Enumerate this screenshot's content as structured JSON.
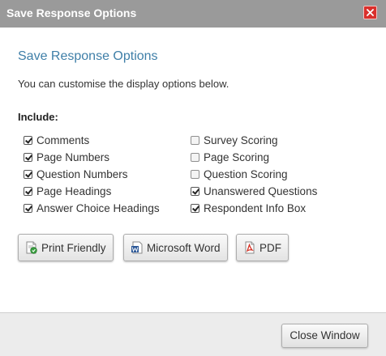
{
  "dialog": {
    "title": "Save Response Options",
    "heading": "Save Response Options",
    "description": "You can customise the display options below.",
    "include_label": "Include:"
  },
  "options_left": [
    {
      "label": "Comments",
      "checked": true
    },
    {
      "label": "Page Numbers",
      "checked": true
    },
    {
      "label": "Question Numbers",
      "checked": true
    },
    {
      "label": "Page Headings",
      "checked": true
    },
    {
      "label": "Answer Choice Headings",
      "checked": true
    }
  ],
  "options_right": [
    {
      "label": "Survey Scoring",
      "checked": false
    },
    {
      "label": "Page Scoring",
      "checked": false
    },
    {
      "label": "Question Scoring",
      "checked": false
    },
    {
      "label": "Unanswered Questions",
      "checked": true
    },
    {
      "label": "Respondent Info Box",
      "checked": true
    }
  ],
  "buttons": {
    "print_friendly": "Print Friendly",
    "microsoft_word": "Microsoft Word",
    "pdf": "PDF",
    "close_window": "Close Window"
  },
  "icons": {
    "close": "close-icon",
    "print_friendly": "printer-icon",
    "microsoft_word": "word-document-icon",
    "pdf": "pdf-document-icon"
  },
  "colors": {
    "titlebar": "#9a9a9a",
    "heading": "#3f7fa8",
    "close_button": "#d9302c"
  }
}
